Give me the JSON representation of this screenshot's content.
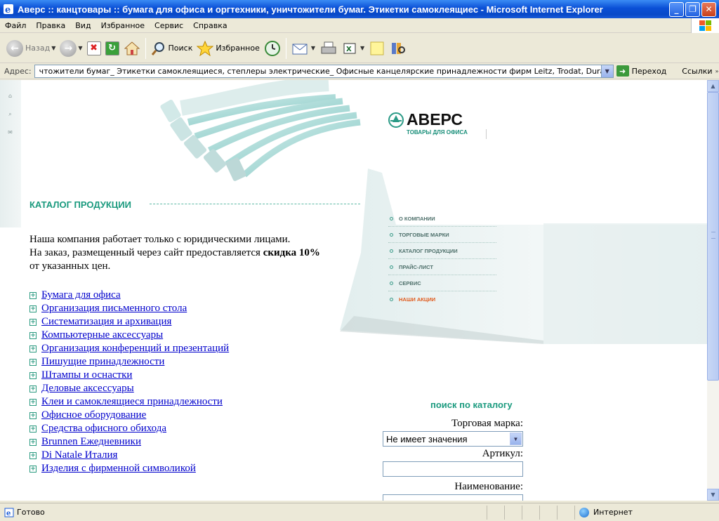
{
  "window": {
    "title": "Аверс :: канцтовары :: бумага для офиса и оргтехники, уничтожители бумаг. Этикетки самоклеящиес - Microsoft Internet Explorer"
  },
  "menu": [
    "Файл",
    "Правка",
    "Вид",
    "Избранное",
    "Сервис",
    "Справка"
  ],
  "toolbar": {
    "back_label": "Назад",
    "search_label": "Поиск",
    "favorites_label": "Избранное"
  },
  "address": {
    "label": "Адрес:",
    "value": "чтожители бумаг_ Этикетки самоклеящиеся, степлеры электрические_ Офисные канцелярские принадлежности фирм Leitz, Trodat, Durable, Esselte.htm",
    "go_label": "Переход",
    "links_label": "Ссылки"
  },
  "page": {
    "logo": {
      "brand": "АВЕРС",
      "tagline": "ТОВАРЫ ДЛЯ ОФИСА"
    },
    "catalog_title": "КАТАЛОГ ПРОДУКЦИИ",
    "nav": [
      {
        "label": "О КОМПАНИИ",
        "active": false
      },
      {
        "label": "ТОРГОВЫЕ МАРКИ",
        "active": false
      },
      {
        "label": "КАТАЛОГ ПРОДУКЦИИ",
        "active": false
      },
      {
        "label": "ПРАЙС-ЛИСТ",
        "active": false
      },
      {
        "label": "СЕРВИС",
        "active": false
      },
      {
        "label": "НАШИ АКЦИИ",
        "active": true
      }
    ],
    "intro": {
      "line1": "Наша компания работает только с юридическими лицами.",
      "line2_pre": "На заказ, размещенный через сайт предоставляется ",
      "line2_bold": "скидка 10%",
      "line2_post": " от указанных цен."
    },
    "categories": [
      "Бумага для офиса",
      "Организация письменного стола",
      "Систематизация и архивация",
      "Компьютерные аксессуары",
      "Организация конференций и презентаций",
      "Пишущие принадлежности",
      "Штампы и оснастки",
      "Деловые аксессуары",
      "Клеи и самоклеящиеся принадлежности",
      "Офисное оборудование",
      "Средства офисного обихода",
      "Brunnen Ежедневники",
      "Di Natale Италия",
      "Изделия с фирменной символикой"
    ],
    "search": {
      "title": "поиск по каталогу",
      "brand_label": "Торговая марка:",
      "brand_value": "Не имеет значения",
      "article_label": "Артикул:",
      "article_value": "",
      "name_label": "Наименование:"
    }
  },
  "status": {
    "text": "Готово",
    "zone": "Интернет"
  },
  "colors": {
    "accent": "#1a9a7e",
    "nav_active": "#e05a1c",
    "link": "#0000cc",
    "titlebar": "#0a4fd6"
  }
}
